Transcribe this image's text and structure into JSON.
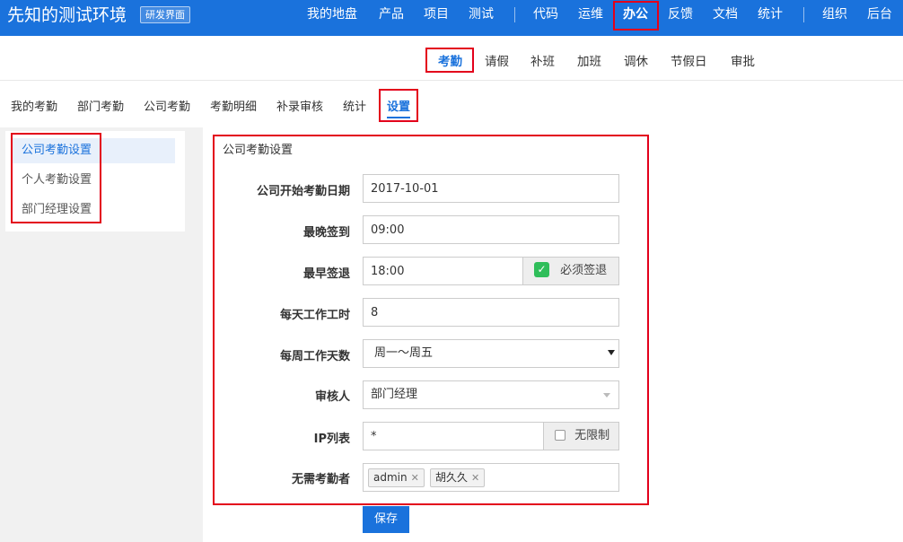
{
  "header": {
    "brand": "先知的测试环境",
    "badge": "研发界面",
    "nav": [
      "我的地盘",
      "产品",
      "项目",
      "测试",
      "代码",
      "运维",
      "办公",
      "反馈",
      "文档",
      "统计",
      "组织",
      "后台"
    ],
    "active": "办公"
  },
  "subnav": {
    "items": [
      "考勤",
      "请假",
      "补班",
      "加班",
      "调休",
      "节假日",
      "审批"
    ],
    "active": "考勤"
  },
  "tabs": {
    "items": [
      "我的考勤",
      "部门考勤",
      "公司考勤",
      "考勤明细",
      "补录审核",
      "统计",
      "设置"
    ],
    "active": "设置"
  },
  "sidebar": {
    "items": [
      "公司考勤设置",
      "个人考勤设置",
      "部门经理设置"
    ],
    "active": "公司考勤设置"
  },
  "form": {
    "title": "公司考勤设置",
    "start_date": {
      "label": "公司开始考勤日期",
      "value": "2017-10-01"
    },
    "latest_signin": {
      "label": "最晚签到",
      "value": "09:00"
    },
    "earliest_signout": {
      "label": "最早签退",
      "value": "18:00",
      "addon": "必须签退",
      "checked": true
    },
    "hours_per_day": {
      "label": "每天工作工时",
      "value": "8"
    },
    "days_per_week": {
      "label": "每周工作天数",
      "value": "周一～周五"
    },
    "reviewer": {
      "label": "审核人",
      "value": "部门经理"
    },
    "ip_list": {
      "label": "IP列表",
      "value": "*",
      "addon": "无限制",
      "checked": false
    },
    "exempt": {
      "label": "无需考勤者",
      "tags": [
        "admin",
        "胡久久"
      ]
    },
    "save": "保存"
  },
  "colors": {
    "accent": "#1a72dc",
    "annotation": "#e3001b",
    "check": "#2fbe5a"
  },
  "icons": {
    "checked": "check-icon",
    "remove": "close-icon",
    "dropdown": "caret-down-icon"
  }
}
